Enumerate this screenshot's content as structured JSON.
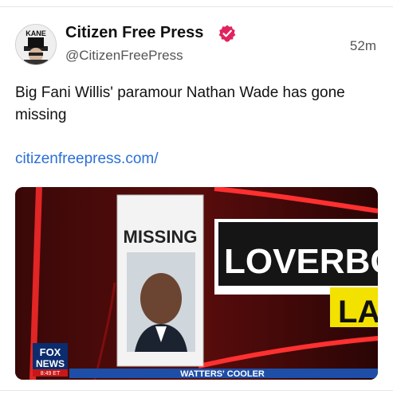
{
  "post": {
    "display_name": "Citizen Free Press",
    "handle": "@CitizenFreePress",
    "timestamp": "52m",
    "text": "Big Fani Willis' paramour Nathan Wade has gone missing",
    "link": "citizenfreepress.com/"
  },
  "avatar": {
    "label": "KANE"
  },
  "media": {
    "missing_label": "MISSING",
    "banner_text": "LOVERBO",
    "banner_sub": "LA",
    "network_logo_line1": "FOX",
    "network_logo_line2": "NEWS",
    "network_time": "8:49 ET",
    "ticker_text": "WATTERS' COOLER"
  },
  "colors": {
    "verified_badge": "#e0245e",
    "link": "#2a6fd6",
    "accent_red": "#c61818",
    "banner_yellow": "#f3e100"
  },
  "icons": {
    "verified": "verified-badge-icon",
    "avatar": "avatar-image"
  }
}
